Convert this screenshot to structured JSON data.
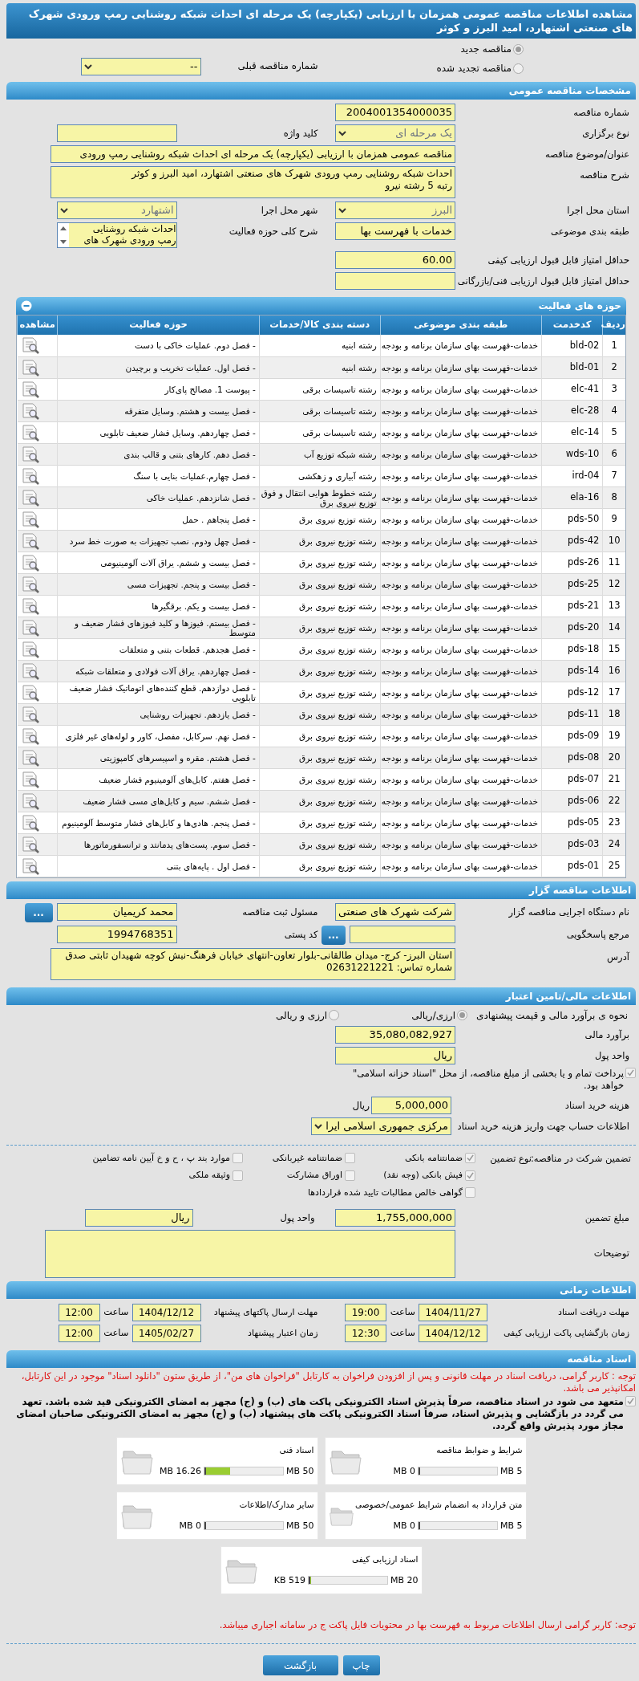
{
  "title": "مشاهده اطلاعات مناقصه عمومی همزمان با ارزیابی (یکپارچه) یک مرحله ای احداث شبکه روشنایی رمپ ورودی شهرک های صنعتی اشتهارد، امید البرز و کوثر",
  "tender_type": [
    {
      "label": "مناقصه جدید",
      "selected": true
    },
    {
      "label": "مناقصه تجدید شده",
      "selected": false
    }
  ],
  "previous_tender": {
    "label": "شماره مناقصه قبلی",
    "kind": "select",
    "value": "--",
    "disabled": false
  },
  "general": {
    "heading": "مشخصات مناقصه عمومی",
    "rows": [
      [
        {
          "label": "شماره مناقصه",
          "kind": "text",
          "value": "2004001354000035"
        }
      ],
      [
        {
          "label": "نوع برگزاری",
          "kind": "select",
          "value": "یک مرحله ای",
          "disabled": true
        },
        {
          "label": "کلید واژه",
          "kind": "text"
        }
      ],
      [
        {
          "label": "عنوان/موضوع مناقصه",
          "kind": "wide-text",
          "value": "مناقصه عمومی همزمان با ارزیابی (یکپارچه) یک مرحله ای احداث شبکه روشنایی رمپ ورودی"
        }
      ],
      [
        {
          "label": "شرح مناقصه",
          "kind": "textarea",
          "lines": [
            "احداث شبکه روشنایی رمپ ورودی شهرک های صنعتی اشتهارد، امید البرز و کوثر",
            "رتبه 5 رشته نیرو"
          ]
        }
      ],
      [
        {
          "label": "استان محل اجرا",
          "kind": "select",
          "value": "البرز",
          "disabled": true
        },
        {
          "label": "شهر محل اجرا",
          "kind": "select",
          "value": "اشتهارد",
          "disabled": true
        }
      ],
      [
        {
          "label": "طبقه بندی موضوعی",
          "kind": "text",
          "value": "خدمات با فهرست بها"
        },
        {
          "label": "شرح کلی حوزه فعالیت",
          "kind": "listbox",
          "lines": [
            "احداث شبکه روشنایی",
            "رمپ ورودی شهرک های"
          ]
        }
      ],
      [
        {
          "label": "حداقل امتیاز قابل قبول ارزیابی کیفی",
          "kind": "text",
          "value": "60.00"
        }
      ],
      [
        {
          "label": "حداقل امتیاز قابل قبول ارزیابی فنی/بازرگانی",
          "kind": "text"
        }
      ]
    ]
  },
  "activities": {
    "heading": "حوزه های فعالیت",
    "expanded": true,
    "columns": [
      "ردیف",
      "کدخدمت",
      "طبقه بندی موضوعی",
      "دسته بندی کالا/خدمات",
      "حوزه فعالیت",
      "مشاهده"
    ],
    "rows": [
      {
        "index": "1",
        "code": "bld-02",
        "category": "خدمات-فهرست بهای سازمان برنامه و بودجه",
        "group": "رشته ابنیه",
        "activity": "- فصل دوم. عملیات خاکی با دست"
      },
      {
        "index": "2",
        "code": "bld-01",
        "category": "خدمات-فهرست بهای سازمان برنامه و بودجه",
        "group": "رشته ابنیه",
        "activity": "- فصل اول. عملیات تخریب و برچیدن"
      },
      {
        "index": "3",
        "code": "elc-41",
        "category": "خدمات-فهرست بهای سازمان برنامه و بودجه",
        "group": "رشته تاسیسات برقی",
        "activity": "- پیوست 1. مصالح پای‌کار"
      },
      {
        "index": "4",
        "code": "elc-28",
        "category": "خدمات-فهرست بهای سازمان برنامه و بودجه",
        "group": "رشته تاسیسات برقی",
        "activity": "- فصل بیست و هشتم. وسایل متفرقه"
      },
      {
        "index": "5",
        "code": "elc-14",
        "category": "خدمات-فهرست بهای سازمان برنامه و بودجه",
        "group": "رشته تاسیسات برقی",
        "activity": "- فصل چهاردهم. وسایل فشار ضعیف تابلویی"
      },
      {
        "index": "6",
        "code": "wds-10",
        "category": "خدمات-فهرست بهای سازمان برنامه و بودجه",
        "group": "رشته شبکه توزیع آب",
        "activity": "- فصل دهم. کارهای بتنی و قالب بندی"
      },
      {
        "index": "7",
        "code": "ird-04",
        "category": "خدمات-فهرست بهای سازمان برنامه و بودجه",
        "group": "رشته آبیاری و زهکشی",
        "activity": "- فصل چهارم.عملیات بنایی با سنگ"
      },
      {
        "index": "8",
        "code": "ela-16",
        "category": "خدمات-فهرست بهای سازمان برنامه و بودجه",
        "group": "رشته خطوط هوایی انتقال و فوق توزیع نیروی برق",
        "activity": "- فصل شانزدهم. عملیات خاکی"
      },
      {
        "index": "9",
        "code": "pds-50",
        "category": "خدمات-فهرست بهای سازمان برنامه و بودجه",
        "group": "رشته توزیع نیروی برق",
        "activity": "- فصل پنجاهم . حمل"
      },
      {
        "index": "10",
        "code": "pds-42",
        "category": "خدمات-فهرست بهای سازمان برنامه و بودجه",
        "group": "رشته توزیع نیروی برق",
        "activity": "- فصل چهل ودوم. نصب تجهیزات به صورت خط سرد"
      },
      {
        "index": "11",
        "code": "pds-26",
        "category": "خدمات-فهرست بهای سازمان برنامه و بودجه",
        "group": "رشته توزیع نیروی برق",
        "activity": "- فصل بیست و ششم. یراق آلات آلومینیومی"
      },
      {
        "index": "12",
        "code": "pds-25",
        "category": "خدمات-فهرست بهای سازمان برنامه و بودجه",
        "group": "رشته توزیع نیروی برق",
        "activity": "- فصل بیست و پنجم. تجهیزات مسی"
      },
      {
        "index": "13",
        "code": "pds-21",
        "category": "خدمات-فهرست بهای سازمان برنامه و بودجه",
        "group": "رشته توزیع نیروی برق",
        "activity": "- فصل بیست و یکم. برقگیرها"
      },
      {
        "index": "14",
        "code": "pds-20",
        "category": "خدمات-فهرست بهای سازمان برنامه و بودجه",
        "group": "رشته توزیع نیروی برق",
        "activity": "- فصل بیستم. فیوزها و کلید فیوزهای فشار ضعیف و متوسط"
      },
      {
        "index": "15",
        "code": "pds-18",
        "category": "خدمات-فهرست بهای سازمان برنامه و بودجه",
        "group": "رشته توزیع نیروی برق",
        "activity": "- فصل هجدهم. قطعات بتنی و متعلقات"
      },
      {
        "index": "16",
        "code": "pds-14",
        "category": "خدمات-فهرست بهای سازمان برنامه و بودجه",
        "group": "رشته توزیع نیروی برق",
        "activity": "- فصل چهاردهم. یراق آلات فولادی و متعلقات شبکه"
      },
      {
        "index": "17",
        "code": "pds-12",
        "category": "خدمات-فهرست بهای سازمان برنامه و بودجه",
        "group": "رشته توزیع نیروی برق",
        "activity": "- فصل دوازدهم. قطع کننده‌های اتوماتیک فشار ضعیف تابلویی"
      },
      {
        "index": "18",
        "code": "pds-11",
        "category": "خدمات-فهرست بهای سازمان برنامه و بودجه",
        "group": "رشته توزیع نیروی برق",
        "activity": "- فصل یازدهم. تجهیزات روشنایی"
      },
      {
        "index": "19",
        "code": "pds-09",
        "category": "خدمات-فهرست بهای سازمان برنامه و بودجه",
        "group": "رشته توزیع نیروی برق",
        "activity": "- فصل نهم. سرکابل، مفصل، کاور و لوله‌های غیر فلزی"
      },
      {
        "index": "20",
        "code": "pds-08",
        "category": "خدمات-فهرست بهای سازمان برنامه و بودجه",
        "group": "رشته توزیع نیروی برق",
        "activity": "- فصل هشتم. مقره و اسپیسرهای کامپوزیتی"
      },
      {
        "index": "21",
        "code": "pds-07",
        "category": "خدمات-فهرست بهای سازمان برنامه و بودجه",
        "group": "رشته توزیع نیروی برق",
        "activity": "- فصل هفتم. کابل‌های آلومینیوم فشار ضعیف"
      },
      {
        "index": "22",
        "code": "pds-06",
        "category": "خدمات-فهرست بهای سازمان برنامه و بودجه",
        "group": "رشته توزیع نیروی برق",
        "activity": "- فصل ششم. سیم و کابل‌های مسی فشار ضعیف"
      },
      {
        "index": "23",
        "code": "pds-05",
        "category": "خدمات-فهرست بهای سازمان برنامه و بودجه",
        "group": "رشته توزیع نیروی برق",
        "activity": "- فصل پنجم. هادی‌ها و کابل‌های فشار متوسط آلومینیوم"
      },
      {
        "index": "24",
        "code": "pds-03",
        "category": "خدمات-فهرست بهای سازمان برنامه و بودجه",
        "group": "رشته توزیع نیروی برق",
        "activity": "- فصل سوم. پست‌های پدمانتد و ترانسفورماتورها"
      },
      {
        "index": "25",
        "code": "pds-01",
        "category": "خدمات-فهرست بهای سازمان برنامه و بودجه",
        "group": "رشته توزیع نیروی برق",
        "activity": "- فصل اول . پایه‌های بتنی"
      }
    ]
  },
  "tenderer": {
    "heading": "اطلاعات مناقصه گزار",
    "rows": [
      [
        {
          "label": "نام دستگاه اجرایی مناقصه گزار",
          "kind": "text",
          "value": "شرکت شهرک های صنعتی"
        },
        {
          "label": "مسئول ثبت مناقصه",
          "kind": "text",
          "value": "محمد کریمیان",
          "button": "..."
        }
      ],
      [
        {
          "label": "مرجع پاسخگویی",
          "kind": "text",
          "button": "..."
        },
        {
          "label": "کد پستی",
          "kind": "text",
          "value": "1994768351"
        }
      ],
      [
        {
          "label": "آدرس",
          "kind": "textarea",
          "lines": [
            "استان البرز- کرج- میدان طالقانی-بلوار تعاون-انتهای خیابان فرهنگ-نبش کوچه شهیدان ثابتی صدق",
            "شماره تماس: 02631221221"
          ]
        }
      ]
    ]
  },
  "finance": {
    "heading": "اطلاعات مالی/تامین اعتبار",
    "estimate_method": {
      "label": "نحوه ی برآورد مالی و قیمت پیشنهادی",
      "options": [
        {
          "label": "ارزی/ریالی",
          "selected": true
        },
        {
          "label": "ارزی و ریالی",
          "selected": false
        }
      ]
    },
    "estimate": {
      "label": "برآورد مالی",
      "value": "35,080,082,927"
    },
    "currency": {
      "label": "واحد پول",
      "value": "ریال"
    },
    "treasury": {
      "text": "پرداخت تمام و یا بخشی از مبلغ مناقصه، از محل \"اسناد خزانه اسلامی\" خواهد بود.",
      "checked": true
    },
    "document_fee": {
      "label": "هزینه خرید اسناد",
      "value": "5,000,000",
      "unit": "ریال"
    },
    "account": {
      "label": "اطلاعات حساب جهت واریز هزینه خرید اسناد",
      "value": "مرکزی جمهوری اسلامی ایرا"
    },
    "guarantee": {
      "label": "تضمین شرکت در مناقصه:",
      "type_label": "نوع تضمین",
      "options": [
        {
          "label": "ضمانتنامه بانکی",
          "checked": true
        },
        {
          "label": "ضمانتنامه غیربانکی",
          "checked": false
        },
        {
          "label": "موارد بند پ ، ح و خ آیین نامه تضامین",
          "checked": false
        },
        {
          "label": "فیش بانکی (وجه نقد)",
          "checked": true
        },
        {
          "label": "اوراق مشارکت",
          "checked": false
        },
        {
          "label": "وثیقه ملکی",
          "checked": false
        },
        {
          "label": "گواهی خالص مطالبات تایید شده قراردادها",
          "checked": false
        }
      ]
    },
    "guarantee_amount": {
      "label": "مبلغ تضمین",
      "value": "1,755,000,000"
    },
    "guarantee_currency": {
      "label": "واحد پول",
      "value": "ریال"
    },
    "notes": {
      "label": "توضیحات"
    }
  },
  "timing": {
    "heading": "اطلاعات زمانی",
    "items": [
      {
        "label": "مهلت دریافت اسناد",
        "date": "1404/11/27",
        "time_label": "ساعت",
        "time": "19:00"
      },
      {
        "label": "مهلت ارسال پاکتهای پیشنهاد",
        "date": "1404/12/12",
        "time_label": "ساعت",
        "time": "12:00"
      },
      {
        "label": "زمان بازگشایی پاکت ارزیابی کیفی",
        "date": "1404/12/12",
        "time_label": "ساعت",
        "time": "12:30"
      },
      {
        "label": "زمان اعتبار پیشنهاد",
        "date": "1405/02/27",
        "time_label": "ساعت",
        "time": "12:00"
      }
    ]
  },
  "documents": {
    "heading": "اسناد مناقصه",
    "notice": "توجه : کاربر گرامی، دریافت اسناد در مهلت قانونی و پس از افزودن فراخوان به کارتابل \"فراخوان های من\"، از طریق ستون \"دانلود اسناد\" موجود در این کارتابل، امکانپذیر می باشد.",
    "commitment": {
      "text": "متعهد می شود در اسناد مناقصه، صرفاً پذیرش اسناد الکترونیکی پاکت های (ب) و (ج) مجهز به امضای الکترونیکی قید شده باشد. تعهد می گردد در بازگشایی و پذیرش اسناد، صرفاً اسناد الکترونیکی پاکت های پیشنهاد (ب) و (ج) مجهز به امضای الکترونیکی صاحبان امضای مجاز مورد پذیرش واقع گردد.",
      "checked": true
    },
    "files": [
      {
        "title": "شرایط و ضوابط مناقصه",
        "used": "0 MB",
        "max": "5 MB",
        "level": 0
      },
      {
        "title": "اسناد فنی",
        "used": "16.26 MB",
        "max": "50 MB",
        "level": 0.33
      },
      {
        "title": "متن قرارداد به انضمام شرایط عمومی/خصوصی",
        "used": "0 MB",
        "max": "5 MB",
        "level": 0
      },
      {
        "title": "سایر مدارک/اطلاعات",
        "used": "0 MB",
        "max": "50 MB",
        "level": 0
      },
      {
        "title": "اسناد ارزیابی کیفی",
        "used": "519 KB",
        "max": "20 MB",
        "level": 0.03
      }
    ],
    "footnote": "توجه: کاربر گرامی ارسال اطلاعات مربوط به فهرست بها در محتویات فایل پاکت ج در سامانه اجباری میباشد."
  },
  "buttons": [
    "چاپ",
    "بازگشت"
  ]
}
